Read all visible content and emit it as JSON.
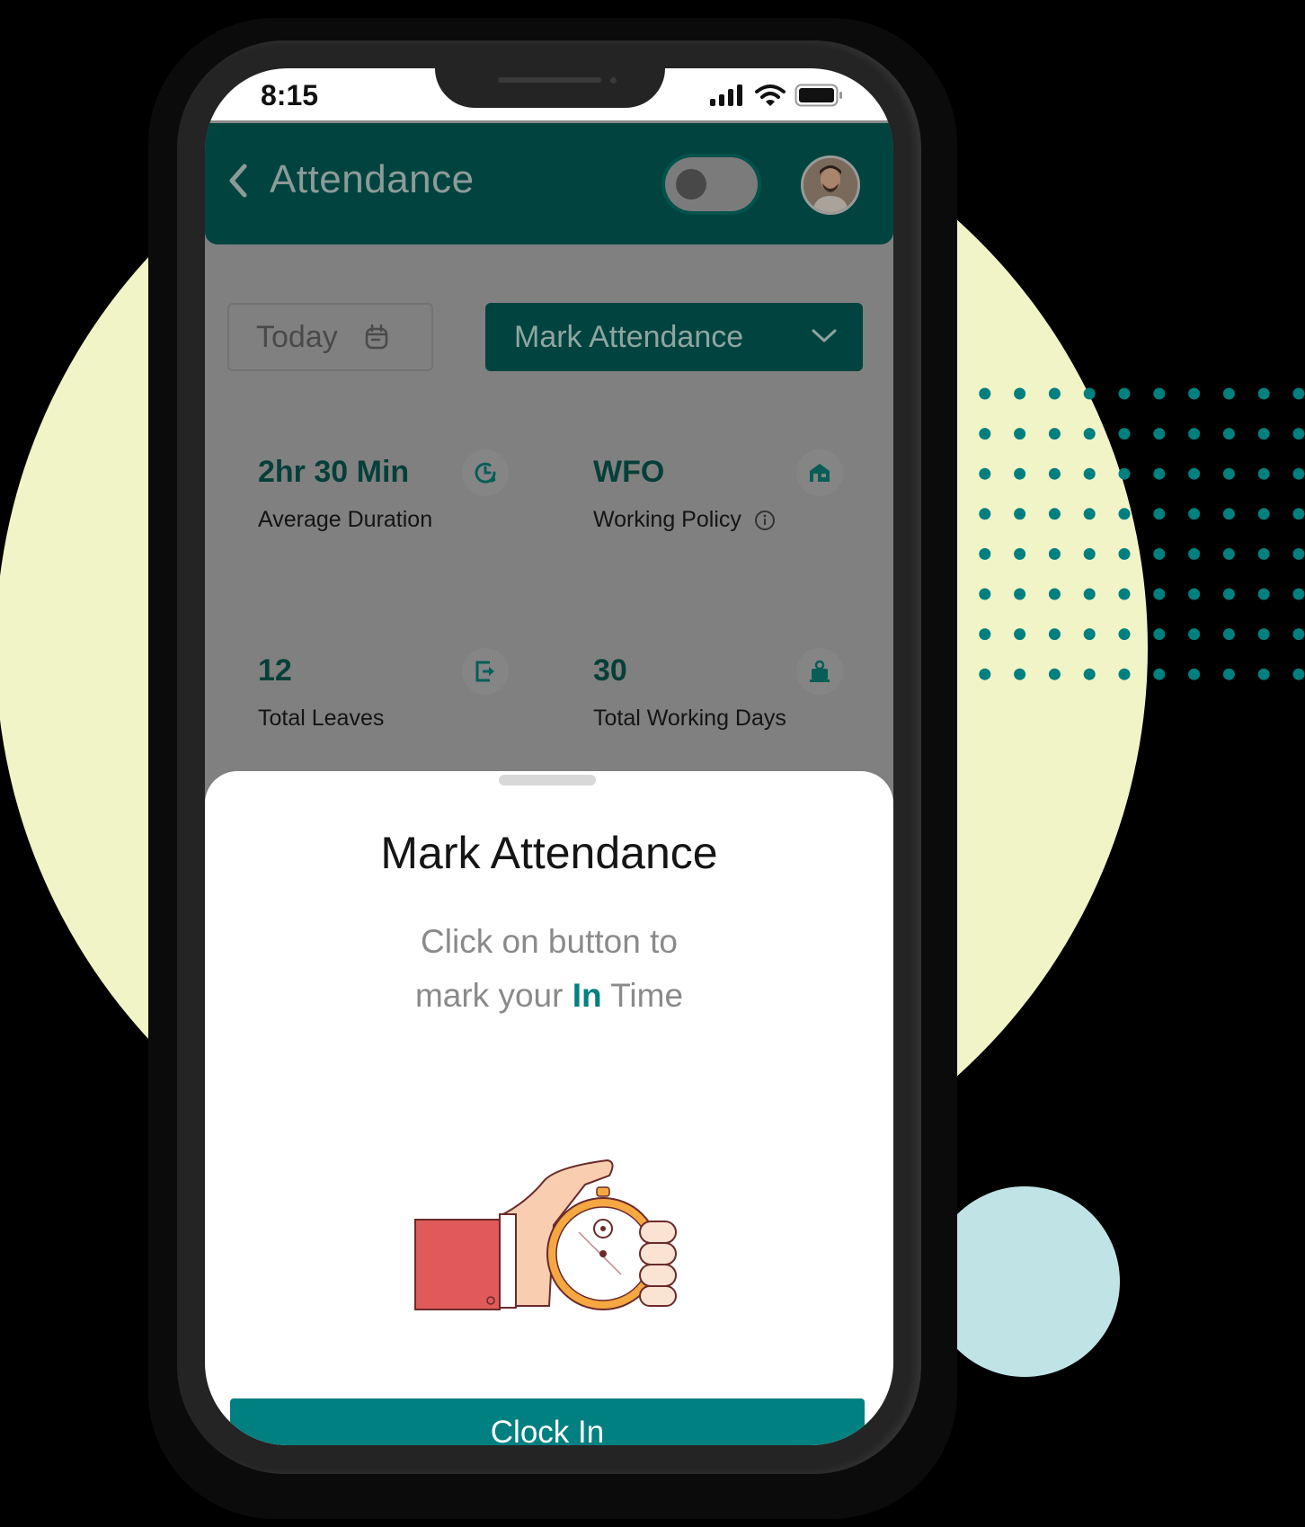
{
  "status_bar": {
    "time": "8:15",
    "icons": [
      "signal-icon",
      "wifi-icon",
      "battery-icon"
    ]
  },
  "header": {
    "title": "Attendance",
    "back_icon": "chevron-left-icon",
    "toggle_state": "off",
    "avatar": "user-avatar"
  },
  "controls": {
    "date_filter": {
      "label": "Today",
      "icon": "calendar-icon"
    },
    "action_dropdown": {
      "label": "Mark Attendance",
      "icon": "chevron-down-icon"
    }
  },
  "stats": [
    {
      "value": "2hr 30 Min",
      "label": "Average Duration",
      "icon": "clock-history-icon"
    },
    {
      "value": "WFO",
      "label": "Working Policy",
      "icon": "house-icon",
      "info_icon": "info-icon"
    },
    {
      "value": "12",
      "label": "Total Leaves",
      "icon": "leave-exit-icon"
    },
    {
      "value": "30",
      "label": "Total Working Days",
      "icon": "work-laptop-icon"
    }
  ],
  "sheet": {
    "title": "Mark Attendance",
    "desc_line1": "Click on button to",
    "desc_line2_pre": "mark your ",
    "desc_highlight": "In",
    "desc_line2_post": " Time",
    "illustration": "hand-holding-stopwatch",
    "button_label": "Clock In"
  },
  "colors": {
    "brand_teal": "#008080",
    "header_dark": "#01443F",
    "background_yellow": "#F1F4C7",
    "accent_light_blue": "#C0E4E6"
  }
}
